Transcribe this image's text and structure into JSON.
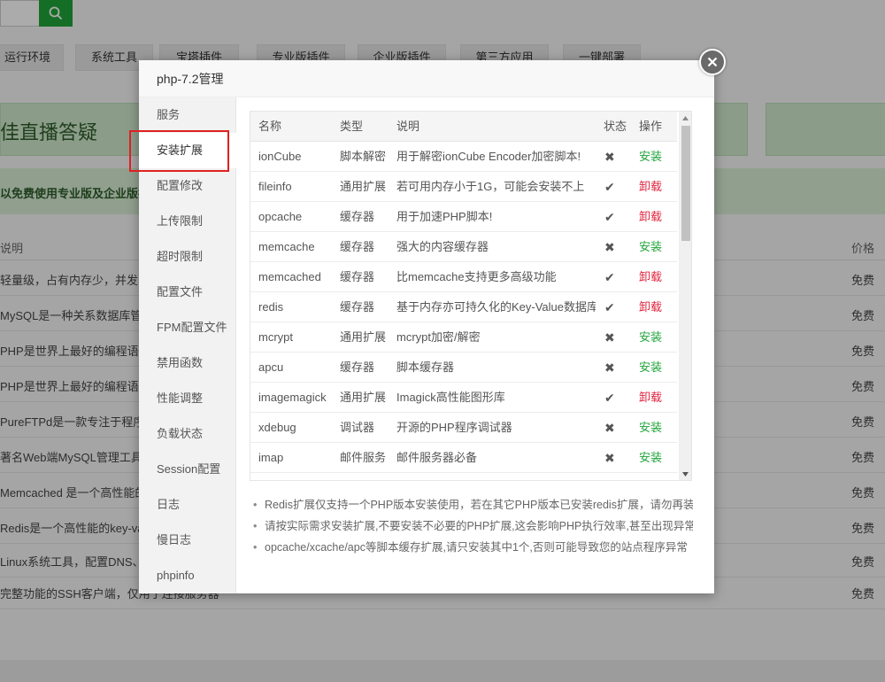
{
  "background": {
    "category_tabs": [
      "运行环境",
      "系统工具",
      "宝塔插件",
      "专业版插件",
      "企业版插件",
      "第三方应用",
      "一键部署"
    ],
    "banner_text": "佳直播答疑",
    "promo_text": "以免费使用专业版及企业版插",
    "table_headers": {
      "desc": "说明",
      "price": "价格"
    },
    "rows": [
      {
        "desc": "轻量级，占有内存少，并发能力",
        "price": "免费"
      },
      {
        "desc": "MySQL是一种关系数据库管理",
        "price": "免费"
      },
      {
        "desc": "PHP是世界上最好的编程语言",
        "price": "免费"
      },
      {
        "desc": "PHP是世界上最好的编程语言",
        "price": "免费"
      },
      {
        "desc": "PureFTPd是一款专注于程序健",
        "price": "免费"
      },
      {
        "desc": "著名Web端MySQL管理工具",
        "price": "免费"
      },
      {
        "desc": "Memcached 是一个高性能的",
        "price": "免费"
      },
      {
        "desc": "Redis是一个高性能的key-valu",
        "price": "免费"
      },
      {
        "desc": "Linux系统工具，配置DNS、S",
        "price": "免费"
      },
      {
        "desc": "完整功能的SSH客户端，仅用于连接服务器",
        "price": "免费"
      }
    ]
  },
  "modal": {
    "title": "php-7.2管理",
    "nav": [
      {
        "label": "服务"
      },
      {
        "label": "安装扩展",
        "active": true
      },
      {
        "label": "配置修改"
      },
      {
        "label": "上传限制"
      },
      {
        "label": "超时限制"
      },
      {
        "label": "配置文件"
      },
      {
        "label": "FPM配置文件"
      },
      {
        "label": "禁用函数"
      },
      {
        "label": "性能调整"
      },
      {
        "label": "负载状态"
      },
      {
        "label": "Session配置"
      },
      {
        "label": "日志"
      },
      {
        "label": "慢日志"
      },
      {
        "label": "phpinfo"
      }
    ],
    "table": {
      "headers": {
        "name": "名称",
        "type": "类型",
        "desc": "说明",
        "status": "状态",
        "op": "操作"
      },
      "rows": [
        {
          "name": "ionCube",
          "type": "脚本解密",
          "desc": "用于解密ionCube Encoder加密脚本!",
          "status": "✖",
          "op": "安装"
        },
        {
          "name": "fileinfo",
          "type": "通用扩展",
          "desc": "若可用内存小于1G，可能会安装不上",
          "status": "✔",
          "op": "卸载"
        },
        {
          "name": "opcache",
          "type": "缓存器",
          "desc": "用于加速PHP脚本!",
          "status": "✔",
          "op": "卸载"
        },
        {
          "name": "memcache",
          "type": "缓存器",
          "desc": "强大的内容缓存器",
          "status": "✖",
          "op": "安装"
        },
        {
          "name": "memcached",
          "type": "缓存器",
          "desc": "比memcache支持更多高级功能",
          "status": "✔",
          "op": "卸载"
        },
        {
          "name": "redis",
          "type": "缓存器",
          "desc": "基于内存亦可持久化的Key-Value数据库",
          "status": "✔",
          "op": "卸载"
        },
        {
          "name": "mcrypt",
          "type": "通用扩展",
          "desc": "mcrypt加密/解密",
          "status": "✖",
          "op": "安装"
        },
        {
          "name": "apcu",
          "type": "缓存器",
          "desc": "脚本缓存器",
          "status": "✖",
          "op": "安装"
        },
        {
          "name": "imagemagick",
          "type": "通用扩展",
          "desc": "Imagick高性能图形库",
          "status": "✔",
          "op": "卸载"
        },
        {
          "name": "xdebug",
          "type": "调试器",
          "desc": "开源的PHP程序调试器",
          "status": "✖",
          "op": "安装"
        },
        {
          "name": "imap",
          "type": "邮件服务",
          "desc": "邮件服务器必备",
          "status": "✖",
          "op": "安装"
        }
      ]
    },
    "notes": [
      "Redis扩展仅支持一个PHP版本安装使用，若在其它PHP版本已安装redis扩展，请勿再装",
      "请按实际需求安装扩展,不要安装不必要的PHP扩展,这会影响PHP执行效率,甚至出现异常",
      "opcache/xcache/apc等脚本缓存扩展,请只安装其中1个,否则可能导致您的站点程序异常"
    ]
  },
  "colors": {
    "accent_green": "#20a53a",
    "uninstall_red": "#e0263f",
    "highlight_red": "#e02020"
  }
}
